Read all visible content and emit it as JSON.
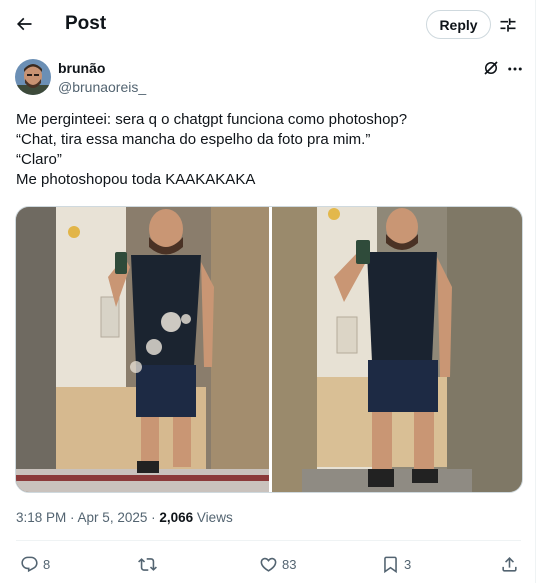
{
  "header": {
    "title": "Post",
    "reply_label": "Reply"
  },
  "author": {
    "name": "brunão",
    "handle": "@brunaoreis_"
  },
  "tweet": {
    "lines": [
      "Me perginteei: sera q o chatgpt funciona como photoshop?",
      "“Chat, tira essa mancha do espelho da foto pra mim.”",
      "“Claro”",
      "Me photoshopou toda KAAKAKAKA"
    ]
  },
  "meta": {
    "time": "3:18 PM",
    "date": "Apr 5, 2025",
    "views_count": "2,066",
    "views_label": "Views"
  },
  "actions": {
    "replies": "8",
    "reposts": "",
    "likes": "83",
    "bookmarks": "3"
  },
  "icons": [
    "back-arrow-icon",
    "settings-icon",
    "grok-icon",
    "more-icon",
    "reply-icon",
    "repost-icon",
    "like-icon",
    "bookmark-icon",
    "share-icon"
  ],
  "colors": {
    "text": "#0f1419",
    "secondary": "#536471",
    "border": "#cfd9de"
  }
}
